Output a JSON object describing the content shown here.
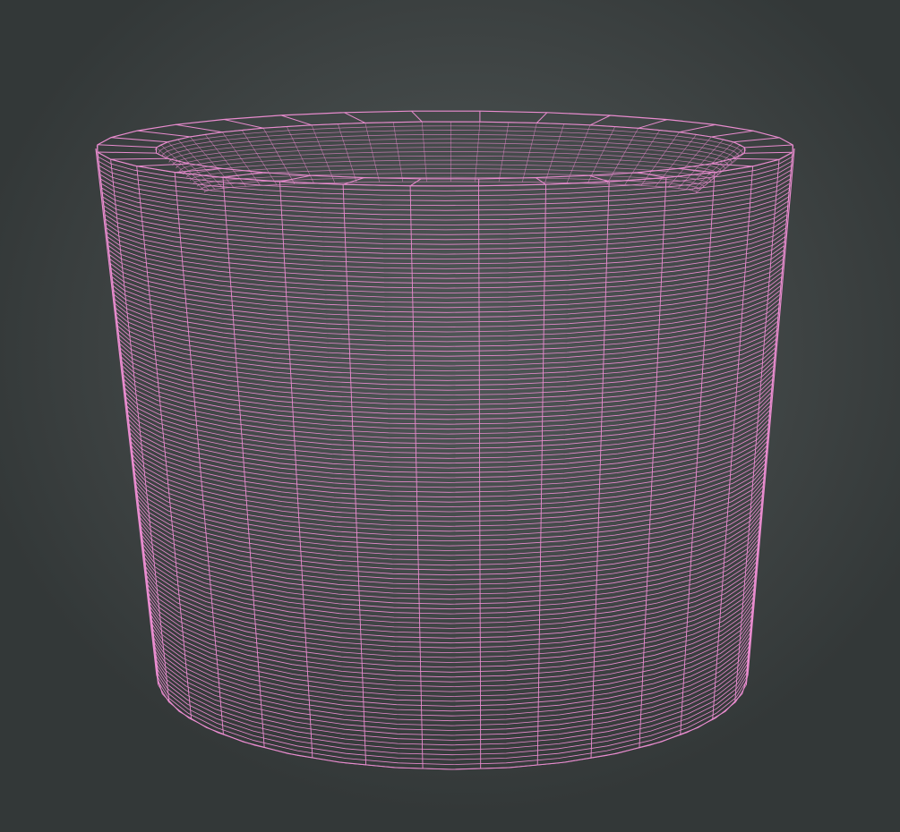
{
  "viewport": {
    "background_color": "#454b4b",
    "wire_color": "#e98ccf"
  },
  "mesh": {
    "object": "cylindrical-shell",
    "render_mode": "wireframe",
    "radial_segments": 32,
    "height_rings": 120
  }
}
